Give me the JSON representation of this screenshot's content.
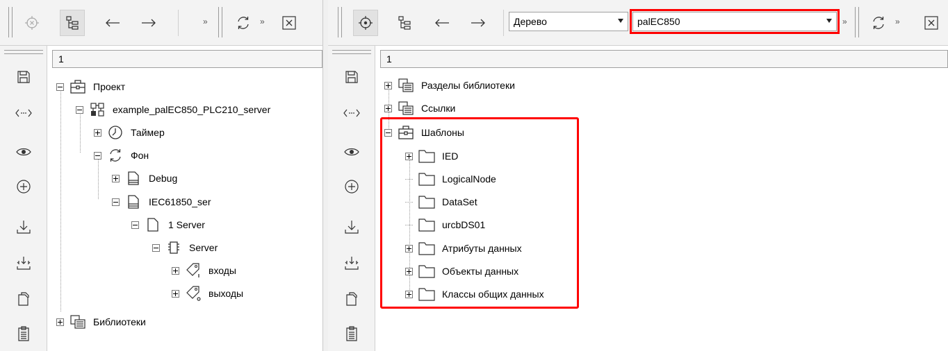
{
  "left": {
    "header": "1",
    "tree": [
      {
        "label": "Проект",
        "icon": "briefcase-icon",
        "expander": "minus"
      },
      {
        "label": "example_palEC850_PLC210_server",
        "icon": "network-nodes-icon",
        "expander": "minus"
      },
      {
        "label": "Таймер",
        "icon": "clock-icon",
        "expander": "plus"
      },
      {
        "label": "Фон",
        "icon": "cycle-arrows-icon",
        "expander": "minus"
      },
      {
        "label": "Debug",
        "icon": "document-stack-icon",
        "expander": "plus"
      },
      {
        "label": "IEC61850_ser",
        "icon": "document-stack-icon",
        "expander": "minus"
      },
      {
        "label": "1 Server",
        "icon": "document-icon",
        "expander": "minus"
      },
      {
        "label": "Server",
        "icon": "chip-icon",
        "expander": "minus"
      },
      {
        "label": "входы",
        "icon": "tag-input-icon",
        "expander": "plus"
      },
      {
        "label": "выходы",
        "icon": "tag-output-icon",
        "expander": "plus"
      },
      {
        "label": "Библиотеки",
        "icon": "library-icon",
        "expander": "plus"
      }
    ]
  },
  "right": {
    "header": "1",
    "view_combo": "Дерево",
    "source_combo": "palEC850",
    "tree": [
      {
        "label": "Разделы библиотеки",
        "icon": "library-icon",
        "expander": "plus"
      },
      {
        "label": "Ссылки",
        "icon": "library-icon",
        "expander": "plus"
      },
      {
        "label": "Шаблоны",
        "icon": "briefcase-icon",
        "expander": "minus"
      },
      {
        "label": "IED",
        "icon": "folder-icon",
        "expander": "plus"
      },
      {
        "label": "LogicalNode",
        "icon": "folder-icon",
        "expander": "none"
      },
      {
        "label": "DataSet",
        "icon": "folder-icon",
        "expander": "none"
      },
      {
        "label": "urcbDS01",
        "icon": "folder-icon",
        "expander": "none"
      },
      {
        "label": "Атрибуты данных",
        "icon": "folder-icon",
        "expander": "plus"
      },
      {
        "label": "Объекты данных",
        "icon": "folder-icon",
        "expander": "plus"
      },
      {
        "label": "Классы общих данных",
        "icon": "folder-icon",
        "expander": "plus"
      }
    ]
  },
  "highlight_color": "#ff0000"
}
